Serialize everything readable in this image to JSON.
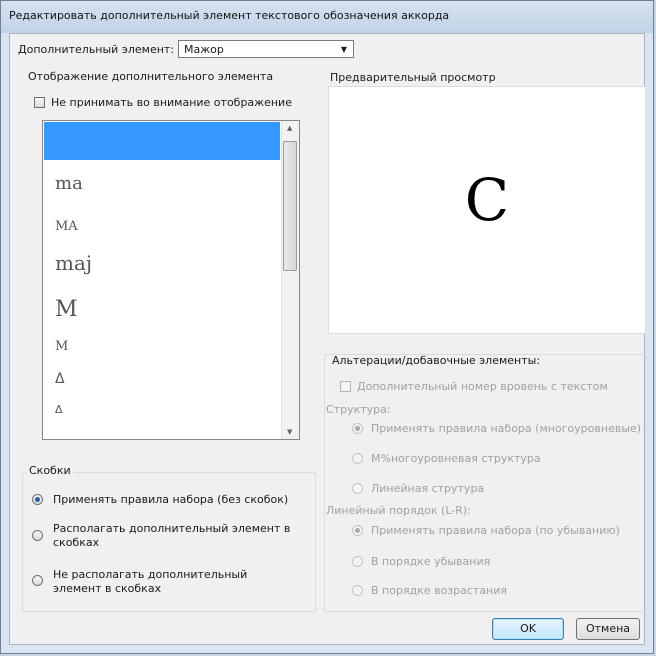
{
  "window": {
    "title": "Редактировать дополнительный элемент текстового обозначения аккорда"
  },
  "element_row": {
    "label": "Дополнительный элемент:",
    "value": "Мажор"
  },
  "display": {
    "heading": "Отображение дополнительного элемента",
    "ignore_label": "Не принимать во внимание отображение",
    "items": [
      "",
      "ma",
      "MA",
      "maj",
      "M",
      "M",
      "Δ",
      "Δ"
    ]
  },
  "preview": {
    "heading": "Предварительный просмотр",
    "glyph": "C"
  },
  "brackets": {
    "heading": "Скобки",
    "options": [
      {
        "label": "Применять правила набора (без скобок)",
        "selected": true
      },
      {
        "label": "Располагать дополнительный элемент в скобках",
        "selected": false
      },
      {
        "label": "Не располагать дополнительный элемент в скобках",
        "selected": false
      }
    ]
  },
  "alterations": {
    "heading": "Альтерации/добавочные элементы:",
    "number_checkbox": "Дополнительный номер вровень с текстом",
    "structure_label": "Структура:",
    "structure_options": [
      {
        "label": "Применять правила набора (многоуровневые)",
        "selected": true
      },
      {
        "label": "М%ногоуровневая структура",
        "selected": false
      },
      {
        "label": "Линейная струтура",
        "selected": false
      }
    ],
    "order_label": "Линейный порядок (L-R):",
    "order_options": [
      {
        "label": "Применять правила набора (по убыванию)",
        "selected": true
      },
      {
        "label": "В порядке убывания",
        "selected": false
      },
      {
        "label": "В порядке возрастания",
        "selected": false
      }
    ]
  },
  "buttons": {
    "ok": "OK",
    "cancel": "Отмена"
  }
}
